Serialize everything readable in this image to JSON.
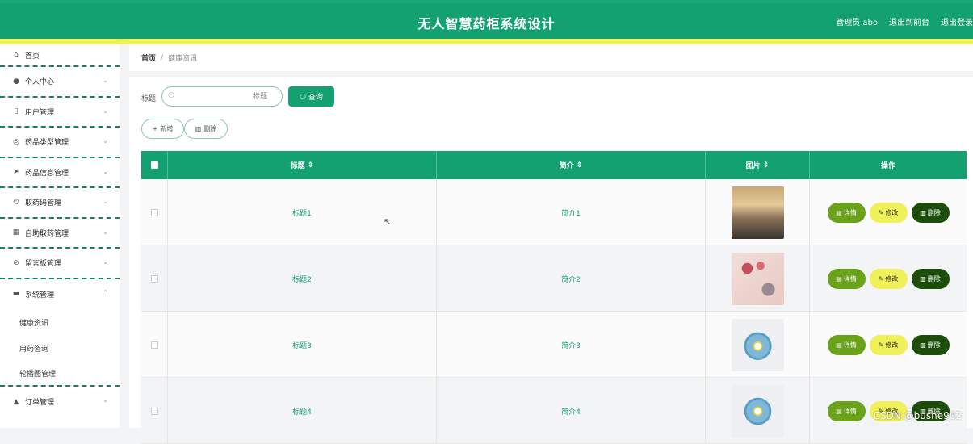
{
  "header": {
    "title": "无人智慧药柜系统设计",
    "links": [
      "管理员 abo",
      "退出到前台",
      "退出登录"
    ]
  },
  "sidebar": {
    "items": [
      {
        "label": "首页",
        "icon": "home-icon",
        "chevron": false
      },
      {
        "label": "个人中心",
        "icon": "user-icon",
        "chevron": true
      },
      {
        "label": "用户管理",
        "icon": "phone-icon",
        "chevron": true
      },
      {
        "label": "药品类型管理",
        "icon": "compass-icon",
        "chevron": true
      },
      {
        "label": "药品信息管理",
        "icon": "send-icon",
        "chevron": true
      },
      {
        "label": "取药码管理",
        "icon": "power-icon",
        "chevron": true
      },
      {
        "label": "自助取药管理",
        "icon": "calendar-icon",
        "chevron": true
      },
      {
        "label": "留言板管理",
        "icon": "bell-off-icon",
        "chevron": true
      },
      {
        "label": "系统管理",
        "icon": "chat-icon",
        "chevron": true,
        "expanded": true
      }
    ],
    "sub_items": [
      "健康资讯",
      "用药咨询",
      "轮播图管理"
    ],
    "last_item": {
      "label": "订单管理",
      "icon": "thumb-icon"
    }
  },
  "breadcrumb": {
    "home": "首页",
    "sep": "/",
    "current": "健康资讯"
  },
  "search": {
    "label": "标题",
    "placeholder": "标题",
    "button": "查询"
  },
  "actions": {
    "add": "新增",
    "delete": "删除"
  },
  "table": {
    "columns": [
      "标题",
      "简介",
      "图片",
      "操作"
    ],
    "sort_icon": "⇕",
    "rows": [
      {
        "title": "标题1",
        "intro": "简介1"
      },
      {
        "title": "标题2",
        "intro": "简介2"
      },
      {
        "title": "标题3",
        "intro": "简介3"
      },
      {
        "title": "标题4",
        "intro": "简介4"
      }
    ],
    "ops": {
      "detail": "详情",
      "edit": "修改",
      "delete": "删除"
    }
  },
  "colors": {
    "primary": "#14a171",
    "yellow": "#f0f05a",
    "detail": "#6aa21a",
    "delete": "#1d4d0a"
  },
  "watermark": "CSDN @bushe902"
}
